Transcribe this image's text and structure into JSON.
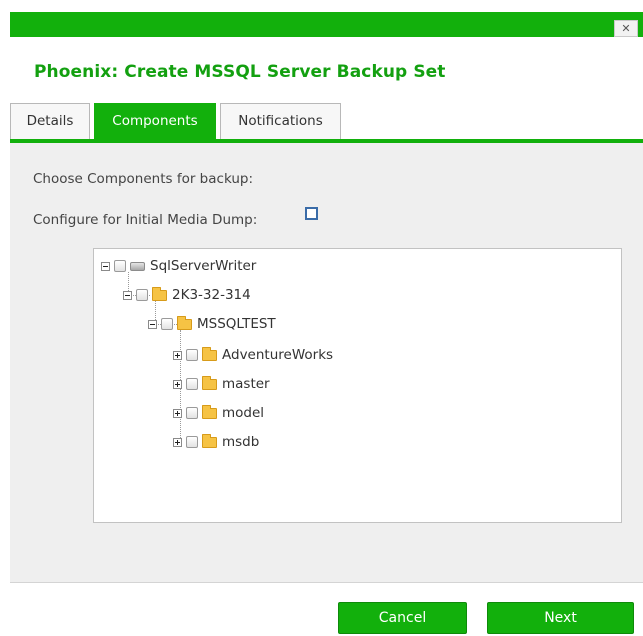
{
  "dialog": {
    "title": "Phoenix: Create MSSQL Server Backup Set",
    "close_glyph": "✕",
    "close_icon": "close-icon"
  },
  "tabs": [
    {
      "label": "Details",
      "active": false
    },
    {
      "label": "Components",
      "active": true
    },
    {
      "label": "Notifications",
      "active": false
    }
  ],
  "components": {
    "heading": "Choose Components for backup:",
    "initial_dump_label": "Configure for Initial Media Dump:",
    "initial_dump_checked": false
  },
  "tree": {
    "root": {
      "label": "SqlServerWriter",
      "expanded": true,
      "checked": false,
      "icon": "drive-icon"
    },
    "server": {
      "label": "2K3-32-314",
      "expanded": true,
      "checked": false,
      "icon": "folder-icon"
    },
    "instance": {
      "label": "MSSQLTEST",
      "expanded": true,
      "checked": false,
      "icon": "folder-icon"
    },
    "databases": [
      {
        "label": "AdventureWorks",
        "expanded": false,
        "checked": false,
        "icon": "folder-icon"
      },
      {
        "label": "master",
        "expanded": false,
        "checked": false,
        "icon": "folder-icon"
      },
      {
        "label": "model",
        "expanded": false,
        "checked": false,
        "icon": "folder-icon"
      },
      {
        "label": "msdb",
        "expanded": false,
        "checked": false,
        "icon": "folder-icon"
      }
    ]
  },
  "footer": {
    "cancel_label": "Cancel",
    "next_label": "Next"
  },
  "colors": {
    "accent": "#12b00c",
    "title": "#13a010",
    "panel": "#efefef",
    "checkbox_border": "#3a6ca8"
  }
}
